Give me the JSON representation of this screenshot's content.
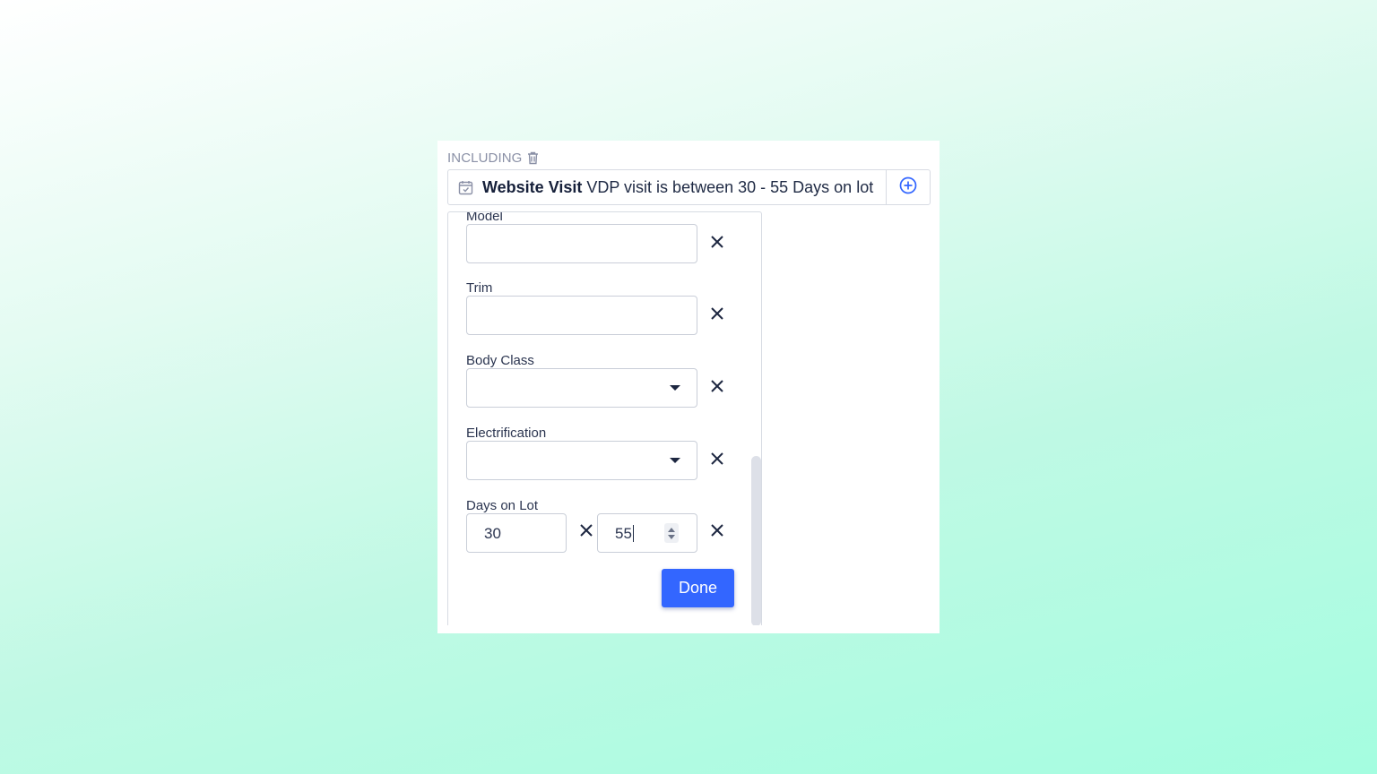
{
  "section": {
    "label": "INCLUDING",
    "delete_icon": "trash-icon"
  },
  "rule": {
    "icon": "calendar-check-icon",
    "title": "Website Visit",
    "description": "VDP visit is between 30 - 55 Days on lot",
    "add_icon": "plus-circle-icon"
  },
  "fields": {
    "model": {
      "label": "Model",
      "value": ""
    },
    "trim": {
      "label": "Trim",
      "value": ""
    },
    "body_class": {
      "label": "Body Class",
      "value": ""
    },
    "electrification": {
      "label": "Electrification",
      "value": ""
    },
    "days_on_lot": {
      "label": "Days on Lot",
      "min": "30",
      "max": "55"
    }
  },
  "actions": {
    "done_label": "Done"
  },
  "colors": {
    "accent": "#3366ff",
    "text": "#2b3550",
    "border": "#c9ced8"
  }
}
